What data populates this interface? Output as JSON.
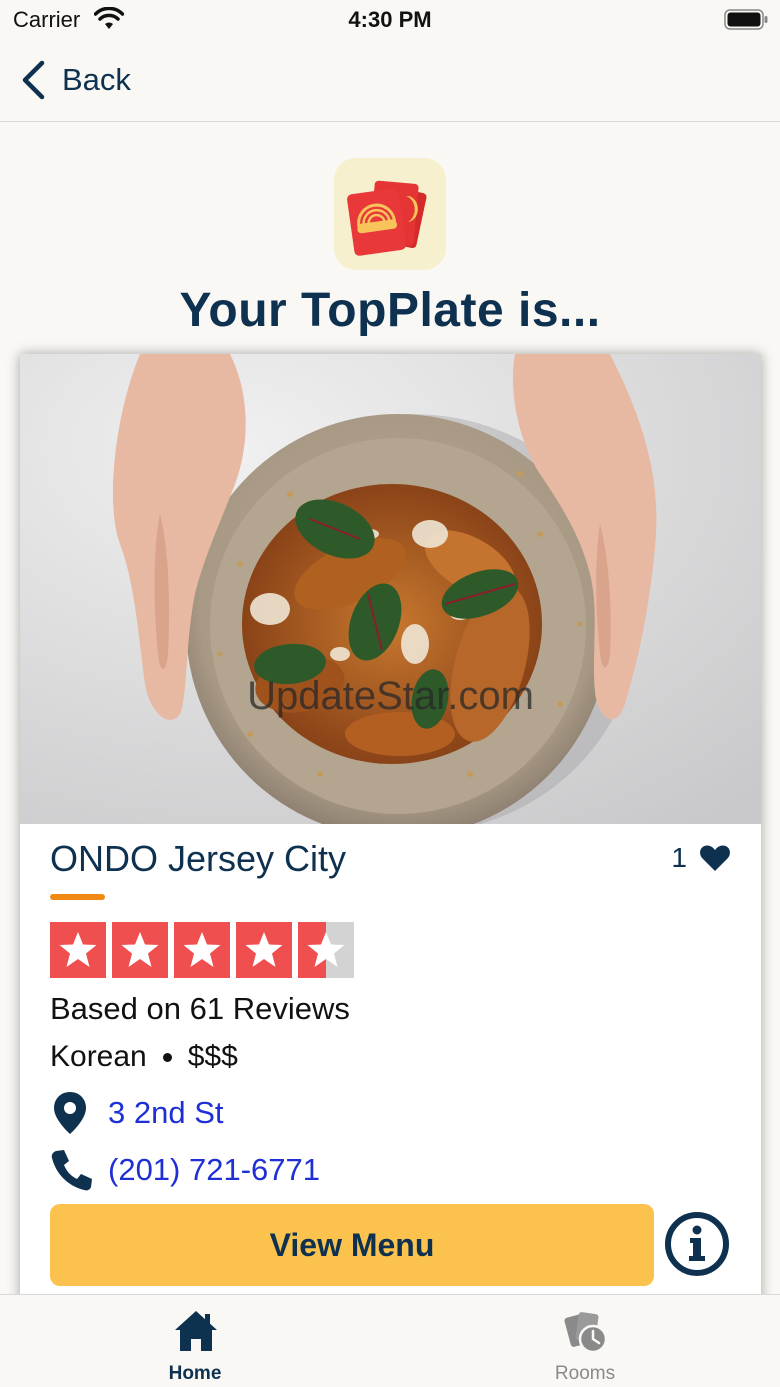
{
  "status_bar": {
    "carrier": "Carrier",
    "time": "4:30 PM"
  },
  "nav": {
    "back_label": "Back"
  },
  "page": {
    "title": "Your TopPlate is..."
  },
  "card": {
    "watermark": "UpdateStar.com",
    "restaurant_name": "ONDO Jersey City",
    "likes": "1",
    "rating": 4.5,
    "rating_max": 5,
    "reviews_text": "Based on 61 Reviews",
    "cuisine": "Korean",
    "price": "$$$",
    "address": "3 2nd St",
    "phone": "(201) 721-6771",
    "menu_button": "View Menu"
  },
  "tabs": [
    {
      "label": "Home",
      "icon": "home-icon",
      "active": true
    },
    {
      "label": "Rooms",
      "icon": "rooms-icon",
      "active": false
    }
  ],
  "colors": {
    "navy": "#0e3150",
    "accent_orange": "#f08a12",
    "star_red": "#ef4f4f",
    "button_yellow": "#fbc34e",
    "link_blue": "#1f2fd6"
  }
}
